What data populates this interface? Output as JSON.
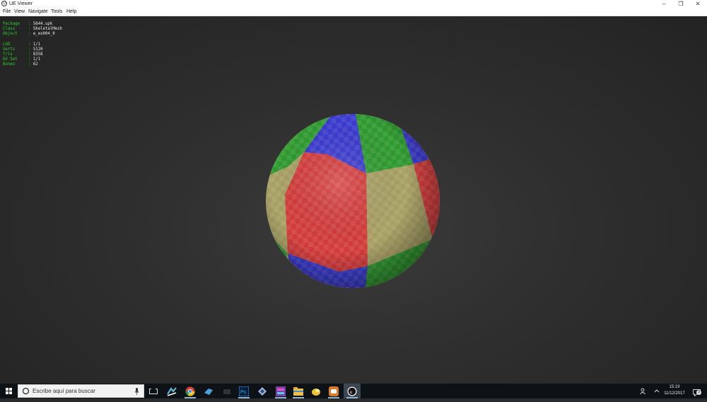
{
  "window": {
    "title": "UE Viewer",
    "controls": {
      "minimize": "–",
      "restore": "❐",
      "close": "✕"
    }
  },
  "menu": [
    "File",
    "View",
    "Navigate",
    "Tools",
    "Help"
  ],
  "info": {
    "rows": [
      {
        "label": "Package",
        "value": "5644.upk"
      },
      {
        "label": "Class",
        "value": "SkeletalMesh"
      },
      {
        "label": "Object",
        "value": "e_ex004_0"
      }
    ],
    "stats": [
      {
        "label": "LOD",
        "value": "1/1"
      },
      {
        "label": "Verts",
        "value": "5120"
      },
      {
        "label": "Tris",
        "value": "8358"
      },
      {
        "label": "UV Set",
        "value": "1/1"
      },
      {
        "label": "Bones",
        "value": "62"
      }
    ],
    "colors": {
      "label": "#2bd12b",
      "value": "#e8e8e8"
    }
  },
  "viewport": {
    "object": "checkered-sphere",
    "colors": {
      "red": "#d43c3c",
      "green": "#2f9b2f",
      "blue": "#3b3bd0",
      "tan": "#a8a064"
    }
  },
  "taskbar": {
    "search_placeholder": "Escribe aquí para buscar",
    "apps": [
      "task-view",
      "app",
      "chrome",
      "app",
      "app",
      "photoshop",
      "app",
      "app",
      "file-explorer",
      "app",
      "discord",
      "unreal"
    ],
    "clock": {
      "time": "15:19",
      "date": "11/12/2017"
    },
    "notification_count": "3"
  }
}
